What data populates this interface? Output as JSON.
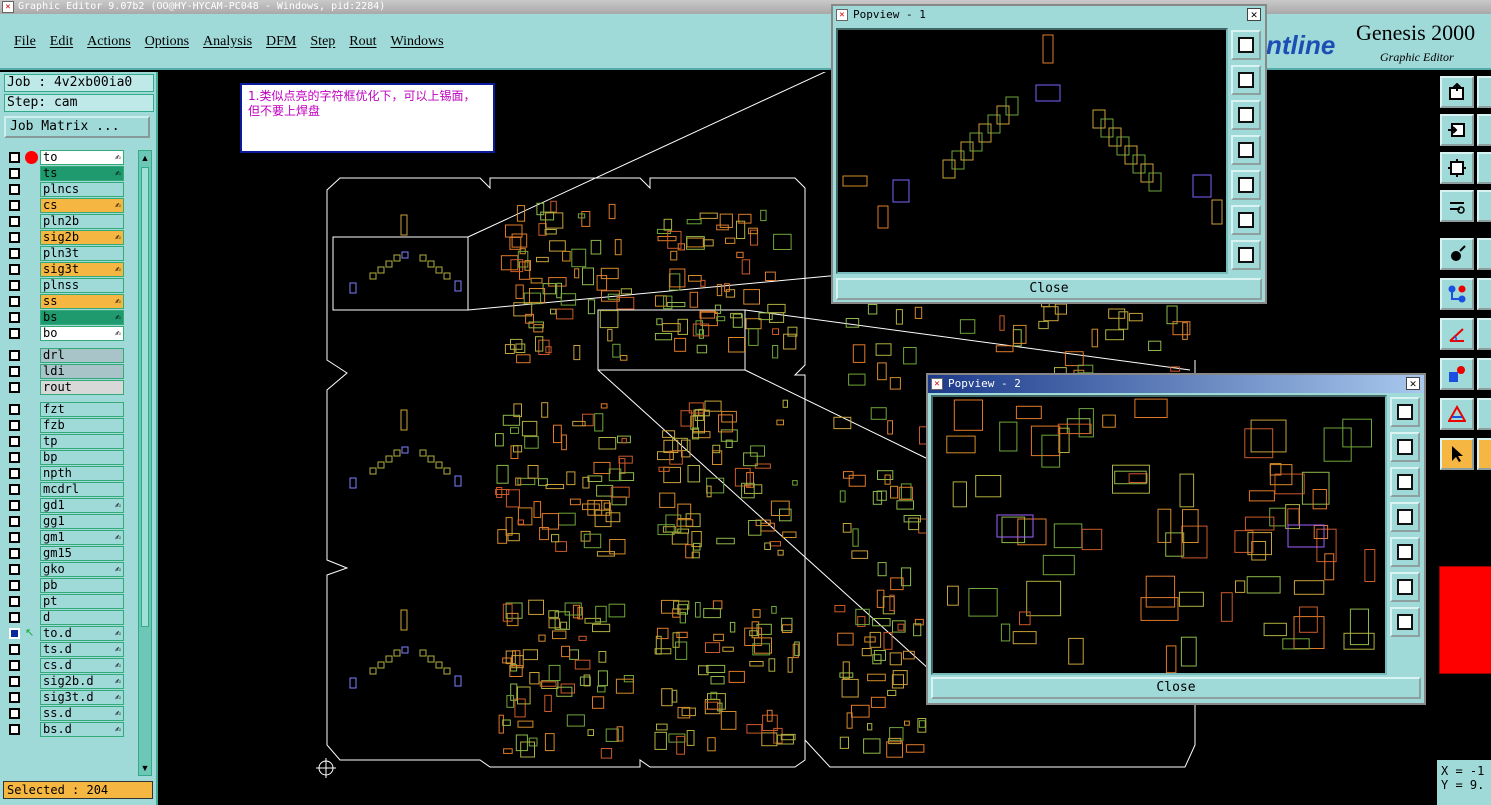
{
  "window": {
    "title": "Graphic Editor 9.07b2 (OO@HY-HYCAM-PC048 - Windows, pid:2284)"
  },
  "menu": {
    "items": [
      "File",
      "Edit",
      "Actions",
      "Options",
      "Analysis",
      "DFM",
      "Step",
      "Rout",
      "Windows"
    ]
  },
  "brand": {
    "partial": "ntline",
    "product": "Genesis 2000",
    "subtitle": "Graphic Editor"
  },
  "job": {
    "job_label": "Job : 4v2xb00ia0",
    "step_label": "Step: cam",
    "matrix_button": "Job Matrix ..."
  },
  "layers": [
    {
      "name": "to",
      "color": "#ffffff",
      "marker": "red-dot",
      "editable": true
    },
    {
      "name": "ts",
      "color": "#1f9a6e",
      "editable": true
    },
    {
      "name": "plncs",
      "color": "#9fd9d8"
    },
    {
      "name": "cs",
      "color": "#f5b742",
      "editable": true
    },
    {
      "name": "pln2b",
      "color": "#9fd9d8"
    },
    {
      "name": "sig2b",
      "color": "#f5b742",
      "editable": true
    },
    {
      "name": "pln3t",
      "color": "#9fd9d8"
    },
    {
      "name": "sig3t",
      "color": "#f5b742",
      "editable": true
    },
    {
      "name": "plnss",
      "color": "#9fd9d8"
    },
    {
      "name": "ss",
      "color": "#f5b742",
      "editable": true
    },
    {
      "name": "bs",
      "color": "#1f9a6e",
      "editable": true
    },
    {
      "name": "bo",
      "color": "#ffffff",
      "editable": true
    },
    {
      "name": "drl",
      "color": "#a8c4c8"
    },
    {
      "name": "ldi",
      "color": "#a8c4c8"
    },
    {
      "name": "rout",
      "color": "#d8d8d8"
    },
    {
      "name": "fzt",
      "color": "#9fd9d8"
    },
    {
      "name": "fzb",
      "color": "#9fd9d8"
    },
    {
      "name": "tp",
      "color": "#9fd9d8"
    },
    {
      "name": "bp",
      "color": "#9fd9d8"
    },
    {
      "name": "npth",
      "color": "#9fd9d8"
    },
    {
      "name": "mcdrl",
      "color": "#9fd9d8"
    },
    {
      "name": "gd1",
      "color": "#9fd9d8",
      "editable": true
    },
    {
      "name": "gg1",
      "color": "#9fd9d8"
    },
    {
      "name": "gm1",
      "color": "#9fd9d8",
      "editable": true
    },
    {
      "name": "gm15",
      "color": "#9fd9d8"
    },
    {
      "name": "gko",
      "color": "#9fd9d8",
      "editable": true
    },
    {
      "name": "pb",
      "color": "#9fd9d8"
    },
    {
      "name": "pt",
      "color": "#9fd9d8"
    },
    {
      "name": "d",
      "color": "#9fd9d8"
    },
    {
      "name": "to.d",
      "color": "#9fd9d8",
      "marker": "pick",
      "editable": true,
      "checked": true
    },
    {
      "name": "ts.d",
      "color": "#9fd9d8",
      "editable": true
    },
    {
      "name": "cs.d",
      "color": "#9fd9d8",
      "editable": true
    },
    {
      "name": "sig2b.d",
      "color": "#9fd9d8",
      "editable": true
    },
    {
      "name": "sig3t.d",
      "color": "#9fd9d8",
      "editable": true
    },
    {
      "name": "ss.d",
      "color": "#9fd9d8",
      "editable": true
    },
    {
      "name": "bs.d",
      "color": "#9fd9d8",
      "editable": true
    }
  ],
  "status": {
    "selected": "Selected : 204"
  },
  "note": {
    "text": "1.类似点亮的字符框优化下，可以上锡面，但不要上焊盘"
  },
  "popview1": {
    "title": "Popview - 1",
    "close_label": "Close"
  },
  "popview2": {
    "title": "Popview - 2",
    "close_label": "Close"
  },
  "coords": {
    "x": "X = -1",
    "y": "Y = 9."
  },
  "colors": {
    "panel": "#9fd9d8",
    "orange": "#f5b742",
    "green_layer": "#1f9a6e",
    "canvas": "#000000",
    "outline": "#ffffff"
  }
}
